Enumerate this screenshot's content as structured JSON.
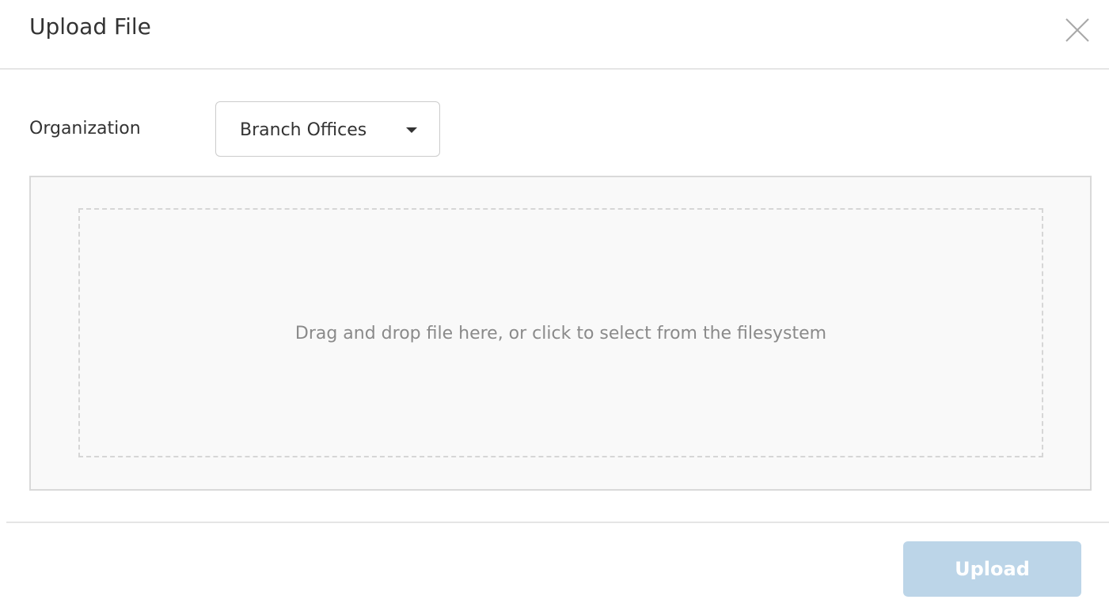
{
  "dialog": {
    "title": "Upload File",
    "close_icon": "close-icon"
  },
  "organization": {
    "label": "Organization",
    "selected": "Branch Offices",
    "caret_icon": "caret-down-icon"
  },
  "dropzone": {
    "text": "Drag and drop file here, or click to select from the filesystem"
  },
  "footer": {
    "upload_label": "Upload",
    "upload_color": "#bcd5e8"
  }
}
